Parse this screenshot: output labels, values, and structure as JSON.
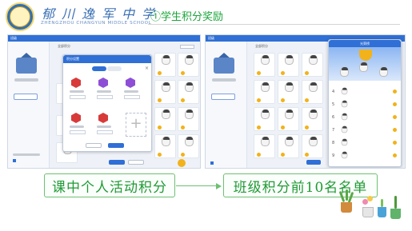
{
  "header": {
    "school_name_cn": "郁川逸军中学",
    "school_name_en": "ZHENGZHOU CHANGYUN MIDDLE SCHOOL",
    "section_title": "①学生积分奖励"
  },
  "left_screen": {
    "titlebar": "班级",
    "tab_label": "全部积分",
    "modal": {
      "title": "积分设置",
      "plus_label": "+"
    }
  },
  "right_screen": {
    "titlebar": "班级",
    "tab_label": "全部积分",
    "ranking": {
      "title": "光荣榜",
      "rows": [
        "4",
        "5",
        "6",
        "7",
        "8",
        "9"
      ]
    }
  },
  "captions": {
    "left": "课中个人活动积分",
    "right": "班级积分前10名名单"
  },
  "colors": {
    "accent": "#2f6fd6",
    "caption_green": "#1f9a35",
    "title_blue": "#3a6fb4",
    "coin": "#f2b21b"
  }
}
